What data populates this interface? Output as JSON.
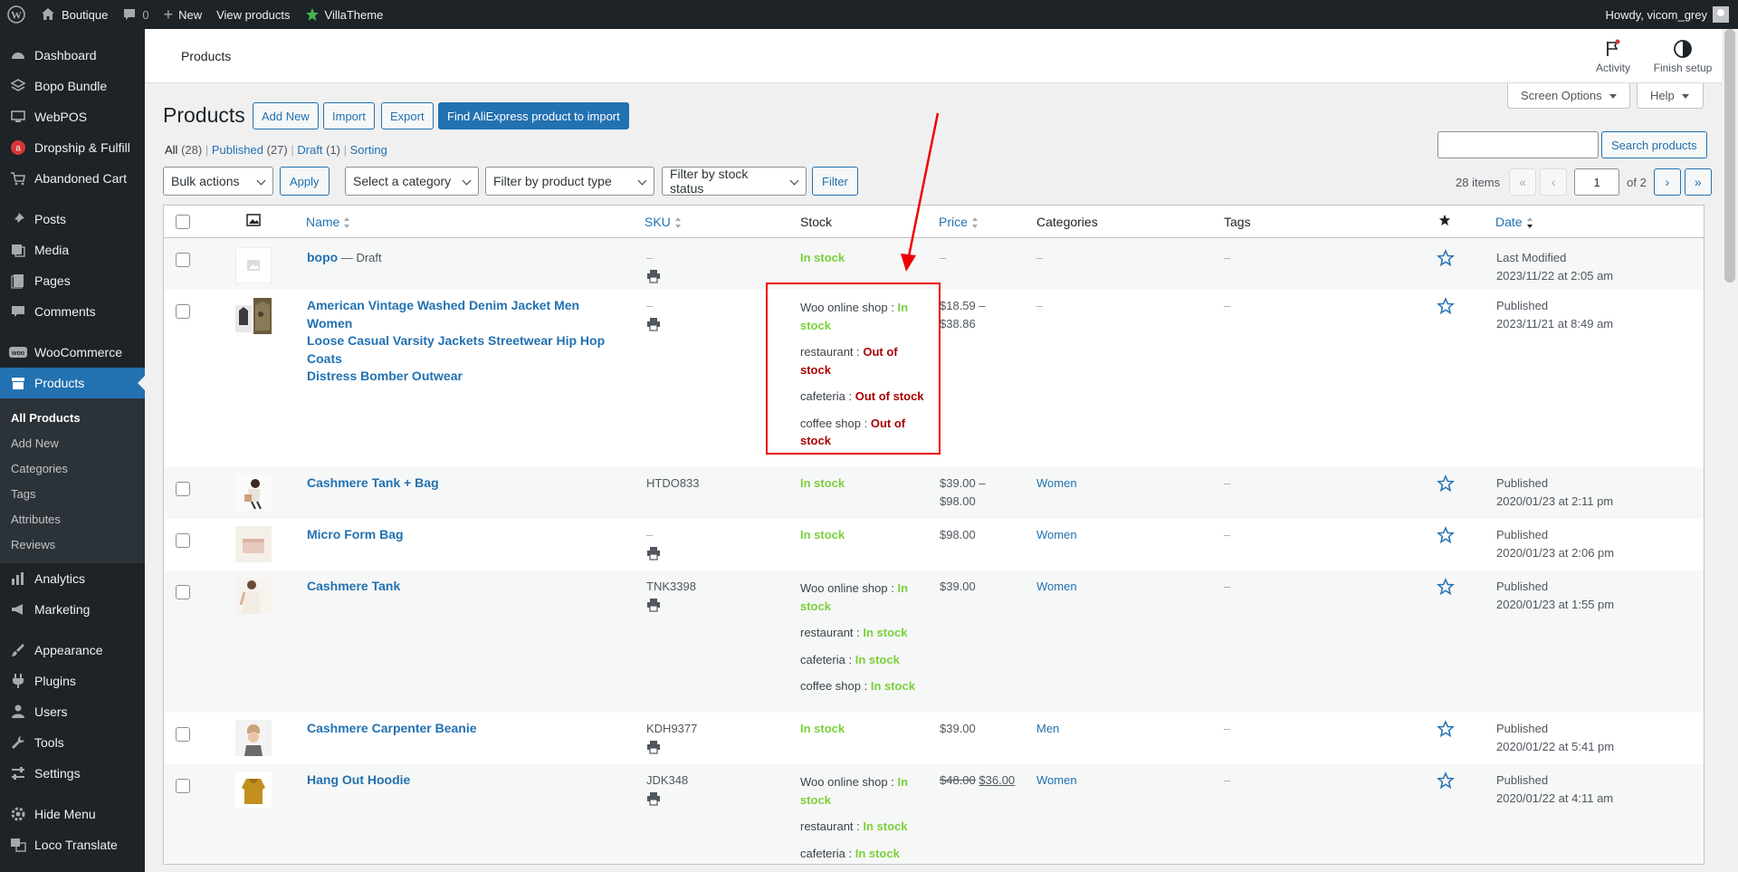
{
  "adminbar": {
    "site": "Boutique",
    "comments": "0",
    "new": "New",
    "view": "View products",
    "villa": "VillaTheme",
    "howdy": "Howdy, vicom_grey"
  },
  "sidebar": {
    "items": [
      {
        "label": "Dashboard"
      },
      {
        "label": "Bopo Bundle"
      },
      {
        "label": "WebPOS"
      },
      {
        "label": "Dropship & Fulfill"
      },
      {
        "label": "Abandoned Cart"
      },
      {
        "label": "Posts"
      },
      {
        "label": "Media"
      },
      {
        "label": "Pages"
      },
      {
        "label": "Comments"
      },
      {
        "label": "WooCommerce"
      },
      {
        "label": "Products"
      },
      {
        "label": "Analytics"
      },
      {
        "label": "Marketing"
      },
      {
        "label": "Appearance"
      },
      {
        "label": "Plugins"
      },
      {
        "label": "Users"
      },
      {
        "label": "Tools"
      },
      {
        "label": "Settings"
      },
      {
        "label": "Hide Menu"
      },
      {
        "label": "Loco Translate"
      }
    ],
    "sub": [
      "All Products",
      "Add New",
      "Categories",
      "Tags",
      "Attributes",
      "Reviews"
    ]
  },
  "topbar": {
    "title": "Products",
    "activity": "Activity",
    "finish": "Finish setup"
  },
  "screen_options": "Screen Options",
  "help": "Help",
  "page": {
    "title": "Products",
    "add_new": "Add New",
    "import": "Import",
    "export": "Export",
    "ali": "Find AliExpress product to import"
  },
  "views": {
    "all": "All",
    "all_count": "(28)",
    "published": "Published",
    "published_count": "(27)",
    "draft": "Draft",
    "draft_count": "(1)",
    "sorting": "Sorting"
  },
  "filters": {
    "bulk": "Bulk actions",
    "apply": "Apply",
    "category": "Select a category",
    "type": "Filter by product type",
    "stock": "Filter by stock status",
    "filter": "Filter",
    "search": "Search products",
    "items": "28 items",
    "page": "1",
    "of": "of 2",
    "first": "«",
    "prev": "‹",
    "next": "›",
    "last": "»"
  },
  "columns": {
    "name": "Name",
    "sku": "SKU",
    "stock": "Stock",
    "price": "Price",
    "categories": "Categories",
    "tags": "Tags",
    "date": "Date"
  },
  "rows": [
    {
      "name": "bopo",
      "suffix": " — Draft",
      "sku": "–",
      "stock": "In stock",
      "price": "–",
      "cat": "–",
      "tags": "–",
      "status": "Last Modified",
      "date": "2023/11/22 at 2:05 am"
    },
    {
      "name_l1": "American Vintage Washed Denim Jacket Men Women",
      "name_l2": "Loose Casual Varsity Jackets Streetwear Hip Hop Coats",
      "name_l3": "Distress Bomber Outwear",
      "sku": "–",
      "stocks": [
        {
          "shop": "Woo online shop : ",
          "v1": "In",
          "v2": "stock"
        },
        {
          "shop": "restaurant : ",
          "v1": "Out of",
          "v2": "stock"
        },
        {
          "shop": "cafeteria : ",
          "v1": "Out of stock"
        },
        {
          "shop": "coffee shop : ",
          "v1": "Out of",
          "v2": "stock"
        }
      ],
      "price1": "$18.59 –",
      "price2": "$38.86",
      "cat": "–",
      "tags": "–",
      "status": "Published",
      "date": "2023/11/21 at 8:49 am"
    },
    {
      "name": "Cashmere Tank + Bag",
      "sku": "HTDO833",
      "stock": "In stock",
      "price1": "$39.00 –",
      "price2": "$98.00",
      "cat": "Women",
      "tags": "–",
      "status": "Published",
      "date": "2020/01/23 at 2:11 pm"
    },
    {
      "name": "Micro Form Bag",
      "sku": "–",
      "stock": "In stock",
      "price": "$98.00",
      "cat": "Women",
      "tags": "–",
      "status": "Published",
      "date": "2020/01/23 at 2:06 pm"
    },
    {
      "name": "Cashmere Tank",
      "sku": "TNK3398",
      "stocks": [
        {
          "shop": "Woo online shop : ",
          "v1": "In",
          "v2": "stock"
        },
        {
          "shop": "restaurant : ",
          "v1": "In stock"
        },
        {
          "shop": "cafeteria : ",
          "v1": "In stock"
        },
        {
          "shop": "coffee shop : ",
          "v1": "In stock"
        }
      ],
      "price": "$39.00",
      "cat": "Women",
      "tags": "–",
      "status": "Published",
      "date": "2020/01/23 at 1:55 pm"
    },
    {
      "name": "Cashmere Carpenter Beanie",
      "sku": "KDH9377",
      "stock": "In stock",
      "price": "$39.00",
      "cat": "Men",
      "tags": "–",
      "status": "Published",
      "date": "2020/01/22 at 5:41 pm"
    },
    {
      "name": "Hang Out Hoodie",
      "sku": "JDK348",
      "stocks": [
        {
          "shop": "Woo online shop : ",
          "v1": "In",
          "v2": "stock"
        },
        {
          "shop": "restaurant : ",
          "v1": "In stock"
        },
        {
          "shop": "cafeteria : ",
          "v1": "In stock"
        }
      ],
      "price_old": "$48.00",
      "price_new": "$36.00",
      "cat": "Women",
      "tags": "–",
      "status": "Published",
      "date": "2020/01/22 at 4:11 am"
    }
  ]
}
